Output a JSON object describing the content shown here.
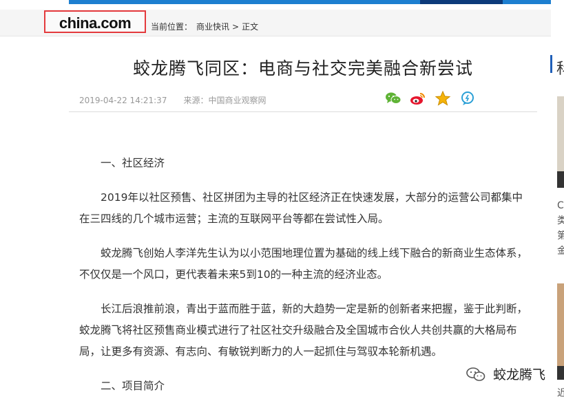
{
  "header": {
    "logo_text": "china.com",
    "breadcrumb_label": "当前位置：",
    "breadcrumb_section": "商业快讯",
    "breadcrumb_separator": ">",
    "breadcrumb_current": "正文"
  },
  "article": {
    "title": "蛟龙腾飞同区：电商与社交完美融合新尝试",
    "date": "2019-04-22 14:21:37",
    "source": "来源：中国商业观察网",
    "paragraphs": [
      "一、社区经济",
      "2019年以社区预售、社区拼团为主导的社区经济正在快速发展，大部分的运营公司都集中在三四线的几个城市运营；主流的互联网平台等都在尝试性入局。",
      "蛟龙腾飞创始人李洋先生认为以小范围地理位置为基础的线上线下融合的新商业生态体系，不仅仅是一个风口，更代表着未来5到10的一种主流的经济业态。",
      "长江后浪推前浪，青出于蓝而胜于蓝，新的大趋势一定是新的创新者来把握，鉴于此判断，蛟龙腾飞将社区预售商业模式进行了社区社交升级融合及全国城市合伙人共创共赢的大格局布局，让更多有资源、有志向、有敏锐判断力的人一起抓住与驾驭本轮新机遇。",
      "二、项目简介"
    ]
  },
  "share_icons": [
    "wechat-icon",
    "weibo-icon",
    "favorite-star-icon",
    "comment-icon"
  ],
  "sidebar": {
    "title_char": "科",
    "text_lines": [
      "C",
      "类",
      "第",
      "金"
    ],
    "bottom_text": "近"
  },
  "watermark": {
    "text": "蛟龙腾飞"
  },
  "colors": {
    "logo_border": "#e4393c",
    "accent_blue": "#1f5fb8",
    "wechat_green": "#5fb336",
    "weibo_red": "#e6162d",
    "star_yellow": "#f5b30a"
  }
}
